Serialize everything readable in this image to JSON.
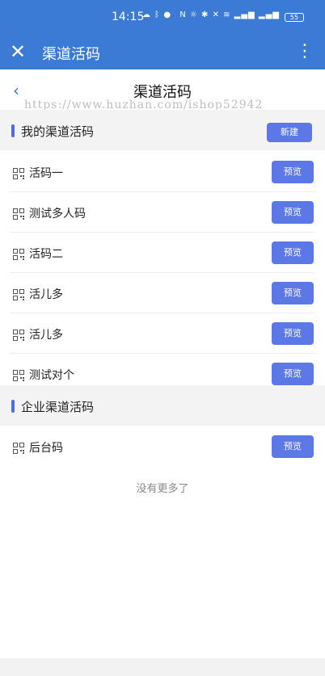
{
  "statusbar": {
    "time": "14:15",
    "left_icons": "☁ ᛒ ●",
    "right_icons": "N ☼ ✱ ✕ ≋ ▂▄▆ ▂▄▆",
    "battery": "55"
  },
  "appbar": {
    "close_glyph": "✕",
    "title": "渠道活码",
    "more_glyph": "⋮"
  },
  "navbar": {
    "back_glyph": "‹",
    "title": "渠道活码",
    "watermark": "https://www.huzhan.com/ishop52942"
  },
  "sections": {
    "mine": {
      "label": "我的渠道活码",
      "new_label": "新建"
    },
    "enterprise": {
      "label": "企业渠道活码"
    }
  },
  "my_codes": [
    {
      "name": "活码一",
      "button": "预览"
    },
    {
      "name": "测试多人码",
      "button": "预览"
    },
    {
      "name": "活码二",
      "button": "预览"
    },
    {
      "name": "活儿多",
      "button": "预览"
    },
    {
      "name": "活儿多",
      "button": "预览"
    },
    {
      "name": "测试对个",
      "button": "预览"
    }
  ],
  "enterprise_codes": [
    {
      "name": "后台码",
      "button": "预览"
    }
  ],
  "footer": {
    "no_more": "没有更多了"
  },
  "colors": {
    "primary": "#3b7bd6",
    "button": "#5b78e6",
    "section_bg": "#f3f3f3"
  },
  "icons": {
    "row_icon": "qr-code-icon"
  }
}
